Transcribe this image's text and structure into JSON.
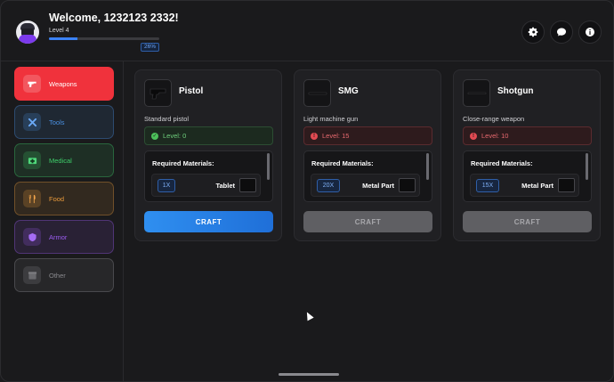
{
  "header": {
    "welcome": "Welcome, 1232123 2332!",
    "level": "Level 4",
    "xp_percent": 26,
    "xp_label": "26%",
    "buttons": [
      "gear-icon",
      "chat-icon",
      "info-icon"
    ]
  },
  "sidebar": {
    "items": [
      {
        "label": "Weapons",
        "icon": "gun-icon",
        "active": true,
        "color": "#f0323c"
      },
      {
        "label": "Tools",
        "icon": "tools-icon",
        "active": false,
        "color": "#4a90e2"
      },
      {
        "label": "Medical",
        "icon": "medkit-icon",
        "active": false,
        "color": "#3ecf6a"
      },
      {
        "label": "Food",
        "icon": "utensils-icon",
        "active": false,
        "color": "#e89a3c"
      },
      {
        "label": "Armor",
        "icon": "shield-icon",
        "active": false,
        "color": "#9b5cf0"
      },
      {
        "label": "Other",
        "icon": "box-icon",
        "active": false,
        "color": "#8a8a8e"
      }
    ]
  },
  "cards": [
    {
      "name": "Pistol",
      "description": "Standard pistol",
      "level_text": "Level: 0",
      "level_ok": true,
      "materials_title": "Required Materials:",
      "material": {
        "qty": "1X",
        "name": "Tablet"
      },
      "craft_label": "CRAFT",
      "craft_enabled": true
    },
    {
      "name": "SMG",
      "description": "Light machine gun",
      "level_text": "Level: 15",
      "level_ok": false,
      "materials_title": "Required Materials:",
      "material": {
        "qty": "20X",
        "name": "Metal Part"
      },
      "craft_label": "CRAFT",
      "craft_enabled": false
    },
    {
      "name": "Shotgun",
      "description": "Close-range weapon",
      "level_text": "Level: 10",
      "level_ok": false,
      "materials_title": "Required Materials:",
      "material": {
        "qty": "15X",
        "name": "Metal Part"
      },
      "craft_label": "CRAFT",
      "craft_enabled": false
    }
  ]
}
